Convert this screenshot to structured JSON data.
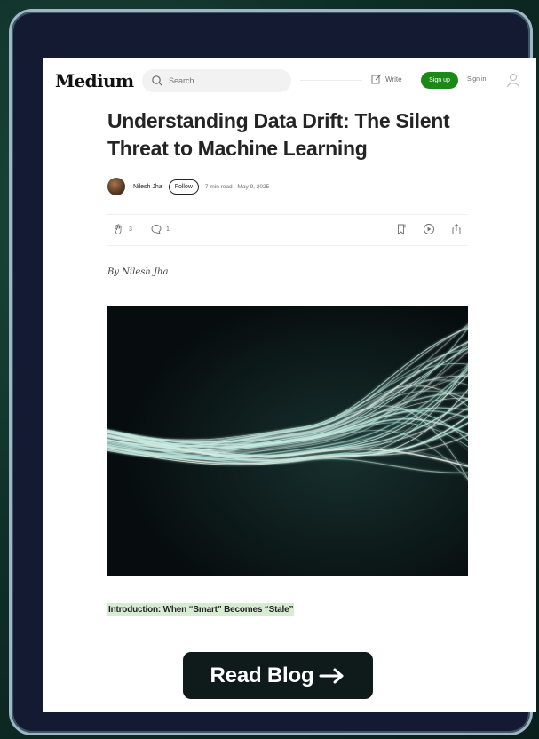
{
  "header": {
    "logo": "Medium",
    "search_placeholder": "Search",
    "write_label": "Write",
    "signup_label": "Sign up",
    "signin_label": "Sign in"
  },
  "article": {
    "title": "Understanding Data Drift: The Silent Threat to Machine Learning",
    "author": "Nilesh Jha",
    "follow_label": "Follow",
    "meta": "7 min read · May 9, 2025",
    "claps": "3",
    "responses": "1",
    "byline": "By Nilesh Jha",
    "intro_heading": "Introduction: When “Smart” Becomes “Stale”"
  },
  "cta": {
    "label": "Read Blog"
  },
  "colors": {
    "background": "#0f2f28",
    "tablet_border": "#9eb7c4",
    "signup_green": "#1a8917",
    "highlight": "#d8ecd4",
    "cta_bg": "#0f1a1a"
  }
}
